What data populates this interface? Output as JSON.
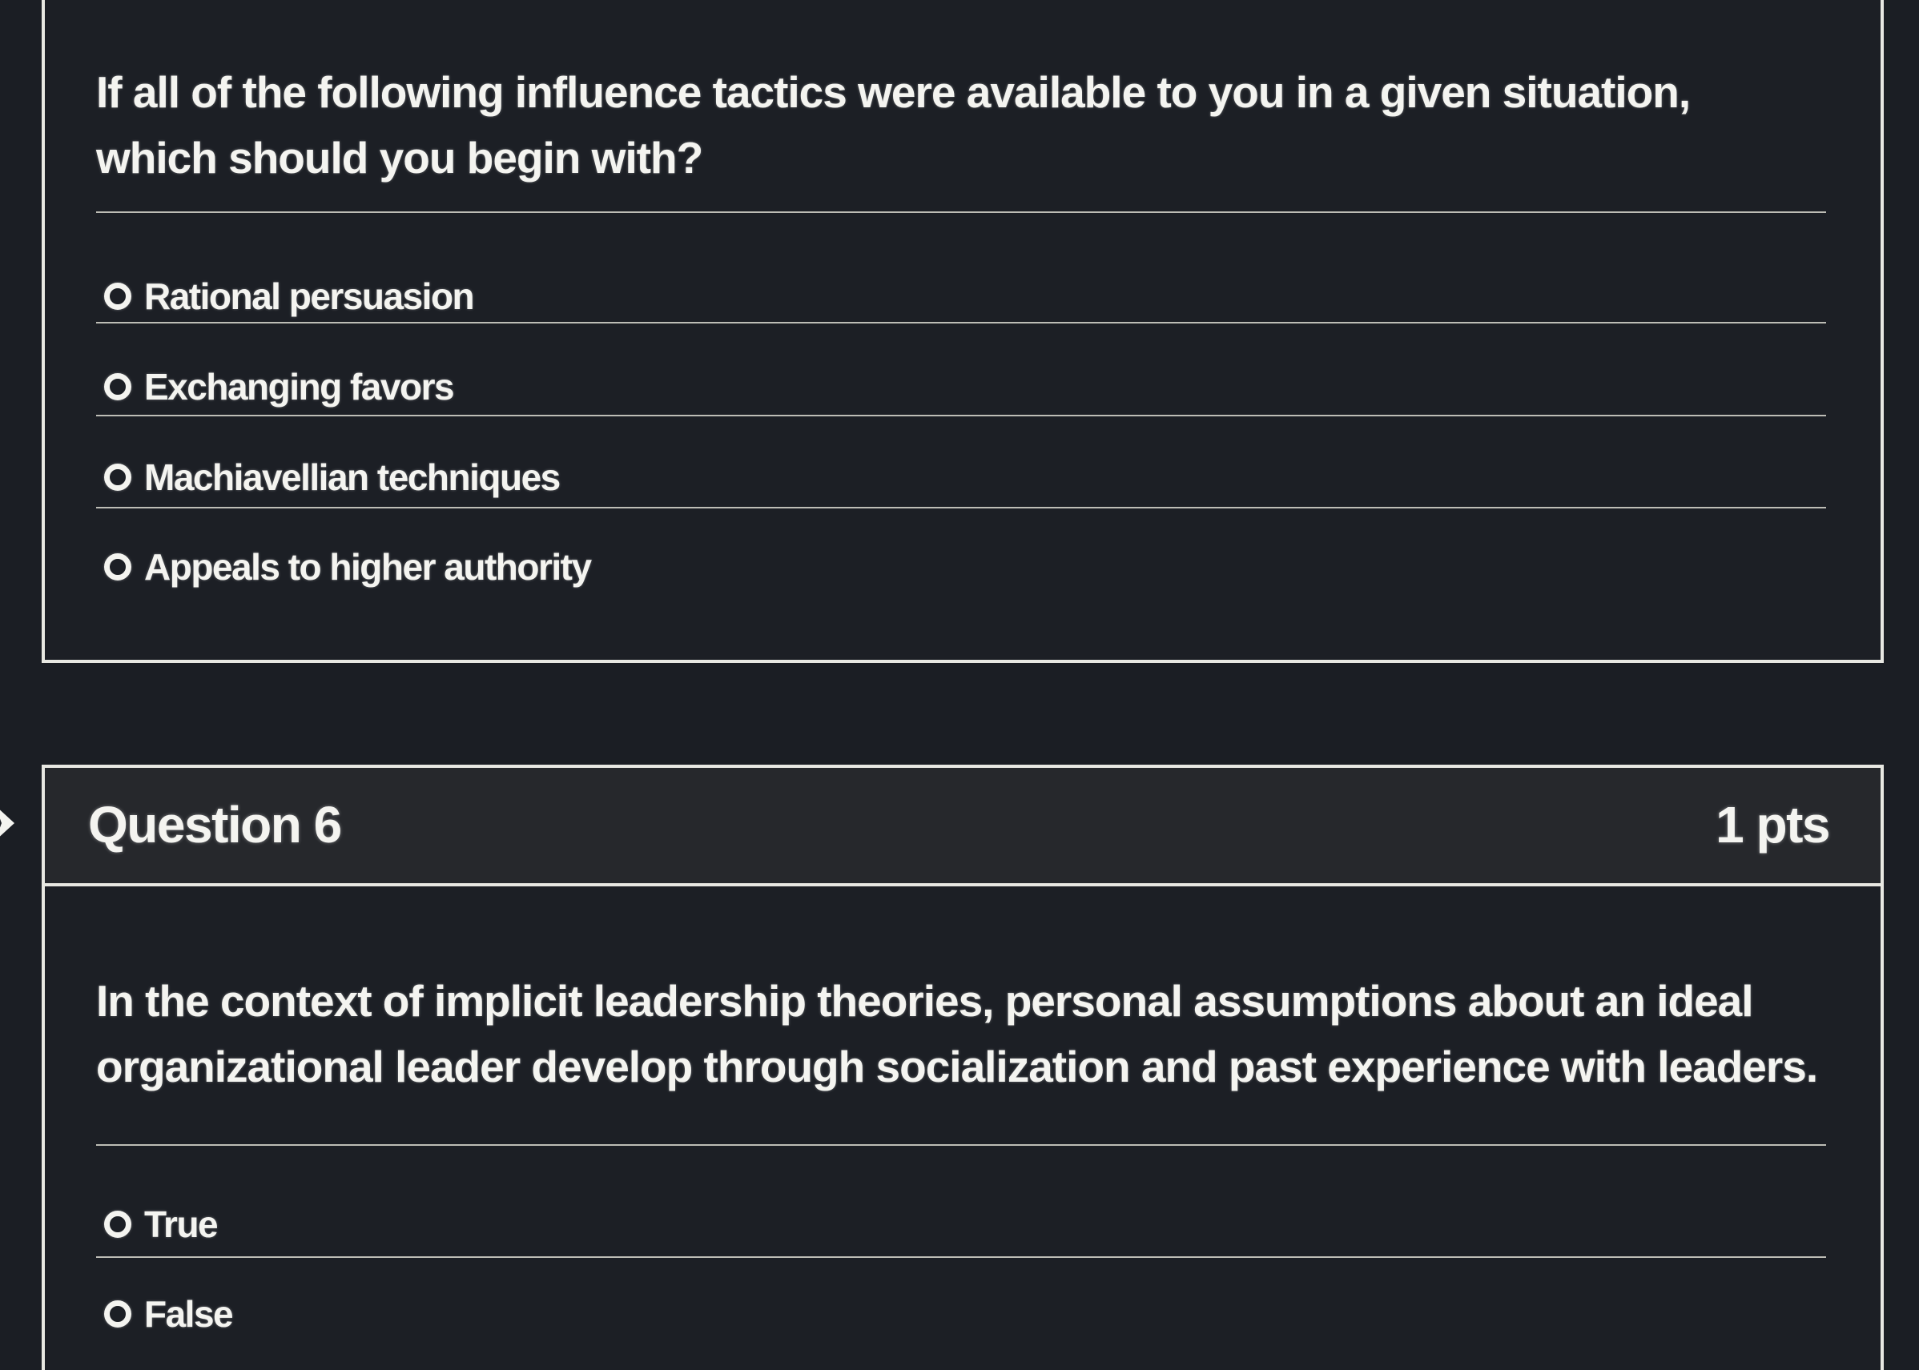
{
  "question5": {
    "text": "If all of the following influence tactics were available to you in a given situation, which should you begin with?",
    "answers": [
      {
        "label": "Rational persuasion"
      },
      {
        "label": "Exchanging favors"
      },
      {
        "label": "Machiavellian techniques"
      },
      {
        "label": "Appeals to higher authority"
      }
    ]
  },
  "question6": {
    "title": "Question 6",
    "points": "1 pts",
    "text": "In the context of implicit leadership theories, personal assumptions about an ideal organizational leader develop through socialization and past experience with leaders.",
    "answers": [
      {
        "label": "True"
      },
      {
        "label": "False"
      }
    ]
  },
  "icons": {
    "question_marker": "chevron-right-icon",
    "answer_radio": "radio-unchecked-icon"
  },
  "colors": {
    "background": "#1b1e24",
    "card_border": "#e8e8e2",
    "header_background": "#26282c",
    "text": "#f4f4f0"
  }
}
